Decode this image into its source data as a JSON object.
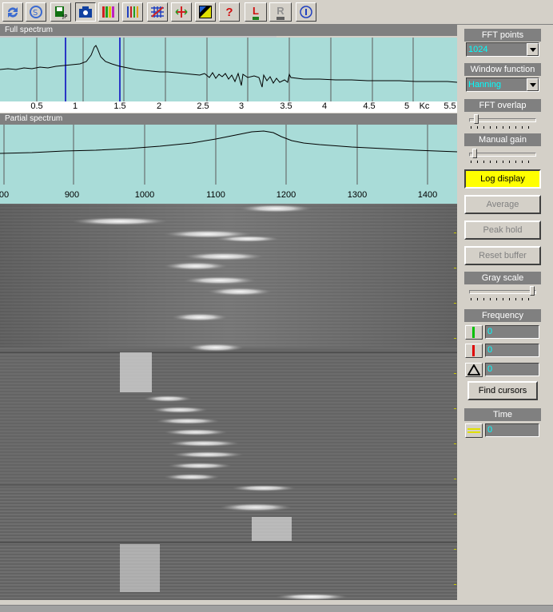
{
  "toolbar": {
    "buttons": [
      {
        "name": "refresh-icon"
      },
      {
        "name": "sync-icon"
      },
      {
        "name": "save-icon"
      },
      {
        "name": "camera-icon"
      },
      {
        "name": "color-bars-icon"
      },
      {
        "name": "gray-bars-icon"
      },
      {
        "name": "grid-icon"
      },
      {
        "name": "axis-icon"
      },
      {
        "name": "contrast-icon"
      },
      {
        "name": "help-icon",
        "glyph": "?"
      },
      {
        "name": "l-marker-icon",
        "glyph": "L"
      },
      {
        "name": "r-marker-icon",
        "glyph": "R"
      },
      {
        "name": "info-icon"
      }
    ]
  },
  "full_spectrum": {
    "title": "Full spectrum",
    "axis_labels": [
      "0.5",
      "1",
      "1.5",
      "2",
      "2.5",
      "3",
      "3.5",
      "4",
      "4.5",
      "5",
      "Kc",
      "5.5"
    ]
  },
  "partial_spectrum": {
    "title": "Partial spectrum",
    "axis_labels": [
      "00",
      "900",
      "1000",
      "1100",
      "1200",
      "1300",
      "1400"
    ]
  },
  "controls": {
    "fft_points": {
      "label": "FFT points",
      "value": "1024"
    },
    "window_function": {
      "label": "Window function",
      "value": "Hanning"
    },
    "fft_overlap": {
      "label": "FFT overlap"
    },
    "manual_gain": {
      "label": "Manual gain"
    },
    "log_display": "Log display",
    "average": "Average",
    "peak_hold": "Peak hold",
    "reset_buffer": "Reset buffer",
    "gray_scale": {
      "label": "Gray scale"
    },
    "frequency": {
      "label": "Frequency",
      "green": "0",
      "red": "0",
      "delta": "0"
    },
    "find_cursors": "Find cursors",
    "time": {
      "label": "Time",
      "value": "0"
    }
  },
  "colors": {
    "plot_bg": "#a9dcd8",
    "header_bg": "#808080",
    "readout_text": "#00ffff",
    "active_button": "#ffff00",
    "cursor_line": "#0000c0"
  }
}
